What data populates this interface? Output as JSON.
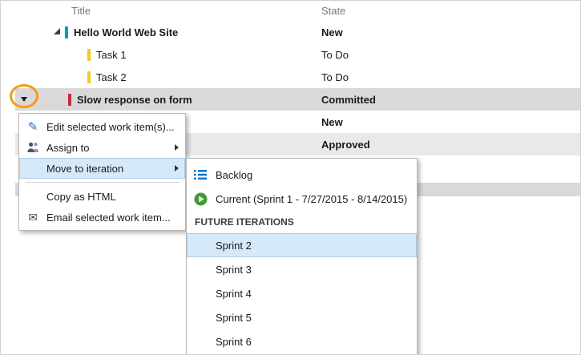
{
  "grid": {
    "header": {
      "title": "Title",
      "state": "State"
    },
    "rows": [
      {
        "title": "Hello World Web Site",
        "state": "New",
        "type": "product-backlog-item"
      },
      {
        "title": "Task 1",
        "state": "To Do",
        "type": "task"
      },
      {
        "title": "Task 2",
        "state": "To Do",
        "type": "task"
      },
      {
        "title": "Slow response on form",
        "state": "Committed",
        "type": "bug"
      },
      {
        "title": "",
        "state": "New"
      },
      {
        "title": "",
        "state": "Approved"
      }
    ]
  },
  "context_menu": {
    "items": [
      {
        "label": "Edit selected work item(s)...",
        "icon": "pencil-icon"
      },
      {
        "label": "Assign to",
        "icon": "people-icon",
        "has_submenu": true
      },
      {
        "label": "Move to iteration",
        "icon": "",
        "has_submenu": true,
        "highlighted": true
      },
      {
        "label": "Copy as HTML",
        "icon": ""
      },
      {
        "label": "Email selected work item...",
        "icon": "mail-icon"
      }
    ]
  },
  "iteration_submenu": {
    "section_header": "FUTURE ITERATIONS",
    "items": [
      {
        "label": "Backlog",
        "icon": "backlog-icon"
      },
      {
        "label": "Current (Sprint 1 - 7/27/2015 - 8/14/2015)",
        "icon": "current-sprint-icon"
      },
      {
        "label": "Sprint 2",
        "highlighted": true
      },
      {
        "label": "Sprint 3"
      },
      {
        "label": "Sprint 4"
      },
      {
        "label": "Sprint 5"
      },
      {
        "label": "Sprint 6"
      }
    ]
  },
  "icons": {
    "pencil_icon": "✎",
    "mail_icon": "✉"
  },
  "colors": {
    "product_backlog_item_bar": "#009ccc",
    "task_bar": "#f2cb1d",
    "bug_bar": "#cc293d",
    "selected_row_bg": "#d9d9d9",
    "light_selected_row_bg": "#e9e9e9",
    "menu_highlight_bg": "#d6e9f8",
    "annotation_circle": "#f39c12",
    "current_sprint_green": "#3f9c35",
    "backlog_icon_blue": "#1072c6"
  }
}
